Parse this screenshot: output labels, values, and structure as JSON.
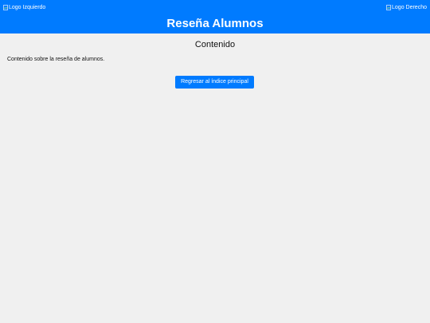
{
  "header": {
    "logo_left_alt": "Logo Izquierdo",
    "logo_right_alt": "Logo Derecho",
    "title": "Reseña Alumnos",
    "background_color": "#007bff"
  },
  "main": {
    "section_heading": "Contenido",
    "content_text": "Contenido sobre la reseña de alumnos.",
    "back_button_label": "Regresar al índice principal"
  },
  "icons": {
    "broken_image": "broken-image-icon"
  }
}
